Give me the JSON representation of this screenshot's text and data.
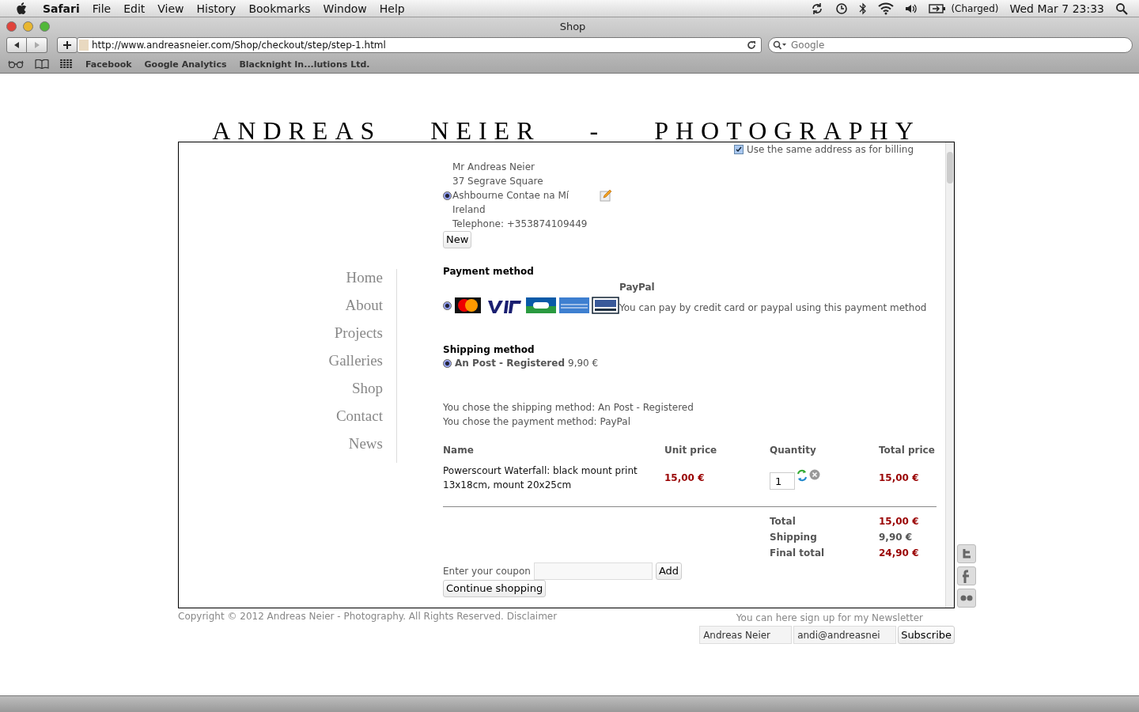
{
  "menubar": {
    "app": "Safari",
    "menus": [
      "File",
      "Edit",
      "View",
      "History",
      "Bookmarks",
      "Window",
      "Help"
    ],
    "battery": "(Charged)",
    "clock": "Wed Mar 7  23:33"
  },
  "browser": {
    "title": "Shop",
    "url": "http://www.andreasneier.com/Shop/checkout/step/step-1.html",
    "search_placeholder": "Google",
    "bookmarks": [
      "Facebook",
      "Google Analytics",
      "Blacknight In...lutions Ltd."
    ]
  },
  "page": {
    "site_title": "ANDREAS  NEIER  -  PHOTOGRAPHY",
    "nav": [
      "Home",
      "About",
      "Projects",
      "Galleries",
      "Shop",
      "Contact",
      "News"
    ],
    "billing_checkbox": {
      "label": "Use the same address as for billing",
      "checked": true
    },
    "address": {
      "selected": true,
      "lines": [
        "Mr Andreas Neier",
        "37 Segrave Square",
        "Ashbourne Contae na Mí",
        "Ireland",
        "Telephone: +353874109449"
      ]
    },
    "new_button": "New",
    "payment": {
      "heading": "Payment method",
      "options": [
        {
          "selected": true,
          "name": "PayPal",
          "description": "You can pay by credit card or paypal using this payment method"
        }
      ]
    },
    "shipping": {
      "heading": "Shipping method",
      "options": [
        {
          "selected": true,
          "name": "An Post - Registered",
          "price": "9,90 €"
        }
      ]
    },
    "summary": [
      "You chose the shipping method: An Post - Registered",
      "You chose the payment method: PayPal"
    ],
    "cart": {
      "columns": [
        "Name",
        "Unit price",
        "Quantity",
        "Total price"
      ],
      "rows": [
        {
          "name": "Powerscourt Waterfall: black mount print 13x18cm, mount 20x25cm",
          "unit_price": "15,00 €",
          "quantity": "1",
          "total": "15,00 €"
        }
      ]
    },
    "totals": [
      {
        "label": "Total",
        "value": "15,00 €",
        "highlight": true
      },
      {
        "label": "Shipping",
        "value": "9,90 €",
        "highlight": false
      },
      {
        "label": "Final total",
        "value": "24,90 €",
        "highlight": true
      }
    ],
    "coupon": {
      "label": "Enter your coupon",
      "button": "Add"
    },
    "continue_button": "Continue shopping",
    "copyright": "Copyright © 2012 Andreas Neier - Photography. All Rights Reserved. Disclaimer",
    "newsletter": {
      "prompt": "You can here sign up for my Newsletter",
      "name_value": "Andreas Neier",
      "email_value": "andi@andreasnei",
      "button": "Subscribe"
    }
  }
}
